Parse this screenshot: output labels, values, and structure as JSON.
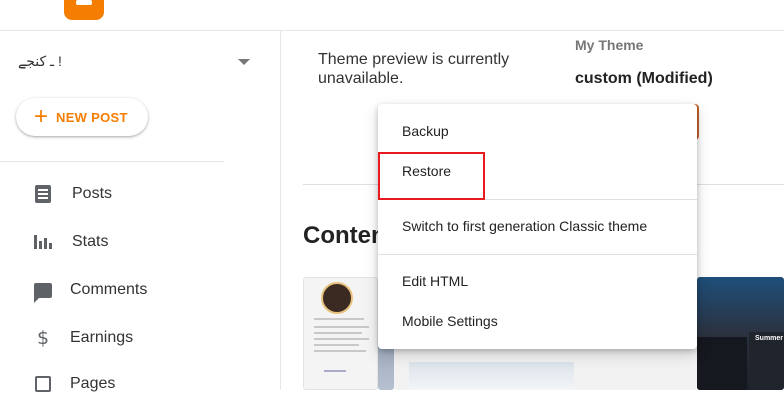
{
  "header": {
    "menu_icon": "hamburger-icon",
    "logo_icon": "blogger-logo-icon"
  },
  "sidebar": {
    "blog_name": "! ـ کنجے",
    "new_post_label": "NEW POST",
    "items": [
      {
        "label": "Posts",
        "icon": "posts-icon"
      },
      {
        "label": "Stats",
        "icon": "stats-icon"
      },
      {
        "label": "Comments",
        "icon": "comments-icon"
      },
      {
        "label": "Earnings",
        "icon": "dollar-icon"
      },
      {
        "label": "Pages",
        "icon": "pages-icon"
      }
    ]
  },
  "main": {
    "preview_unavailable": "Theme preview is currently unavailable.",
    "my_theme_label": "My Theme",
    "theme_name": "custom (Modified)",
    "content_heading": "Conten",
    "thumbnail_caption": "Summer"
  },
  "menu": {
    "items": [
      {
        "label": "Backup"
      },
      {
        "label": "Restore"
      },
      {
        "label": "Switch to first generation Classic theme"
      },
      {
        "label": "Edit HTML"
      },
      {
        "label": "Mobile Settings"
      }
    ]
  },
  "colors": {
    "accent": "#f57d00",
    "highlight": "#e8191f"
  }
}
